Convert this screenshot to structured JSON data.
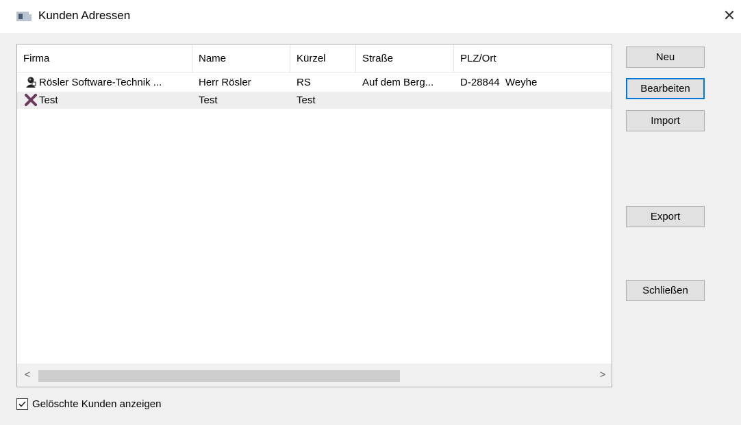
{
  "window": {
    "title": "Kunden Adressen",
    "close_glyph": "✕",
    "icon": "window-icon"
  },
  "list": {
    "columns": [
      "Firma",
      "Name",
      "Kürzel",
      "Straße",
      "PLZ/Ort"
    ],
    "rows": [
      {
        "icon": "person-icon",
        "firma": "Rösler Software-Technik ...",
        "name": "Herr Rösler",
        "kuerzel": "RS",
        "strasse": "Auf dem Berg...",
        "plz_ort": "D-28844  Weyhe",
        "selected": false
      },
      {
        "icon": "deleted-x-icon",
        "firma": "Test",
        "name": "Test",
        "kuerzel": "Test",
        "strasse": "",
        "plz_ort": "",
        "selected": true
      }
    ],
    "scroll_left": "<",
    "scroll_right": ">"
  },
  "buttons": {
    "neu": "Neu",
    "bearbeiten": "Bearbeiten",
    "import": "Import",
    "export": "Export",
    "schliessen": "Schließen"
  },
  "options": {
    "show_deleted_label": "Gelöschte Kunden anzeigen",
    "show_deleted_checked": true
  },
  "colors": {
    "accent": "#0078d7",
    "deleted_x": "#6b3a5a"
  }
}
